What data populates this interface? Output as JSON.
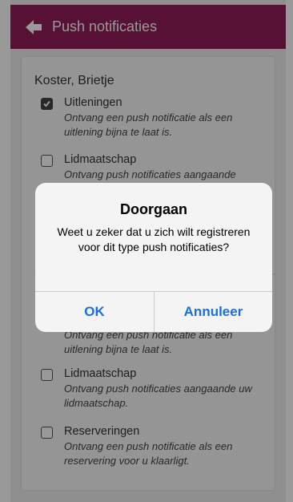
{
  "header": {
    "title": "Push notificaties",
    "back_icon": "arrow-left-icon",
    "color": "#8f1d57"
  },
  "account": {
    "name": "Koster, Brietje"
  },
  "items_top": [
    {
      "title": "Uitleningen",
      "description": "Ontvang een push notificatie als een uitlening bijna te laat is.",
      "checked": true
    },
    {
      "title": "Lidmaatschap",
      "description": "Ontvang push notificaties aangaande",
      "checked": false
    }
  ],
  "items_bottom": [
    {
      "description": "Ontvang een push notificatie als een uitlening bijna te laat is."
    },
    {
      "title": "Lidmaatschap",
      "description": "Ontvang push notificaties aangaande uw lidmaatschap.",
      "checked": false
    },
    {
      "title": "Reserveringen",
      "description": "Ontvang een push notificatie als een reservering voor u klaarligt.",
      "checked": false
    }
  ],
  "dialog": {
    "title": "Doorgaan",
    "message": "Weet u zeker dat u zich wilt registreren voor dit type push notificaties?",
    "ok_label": "OK",
    "cancel_label": "Annuleer",
    "button_color": "#1a6fe0"
  }
}
